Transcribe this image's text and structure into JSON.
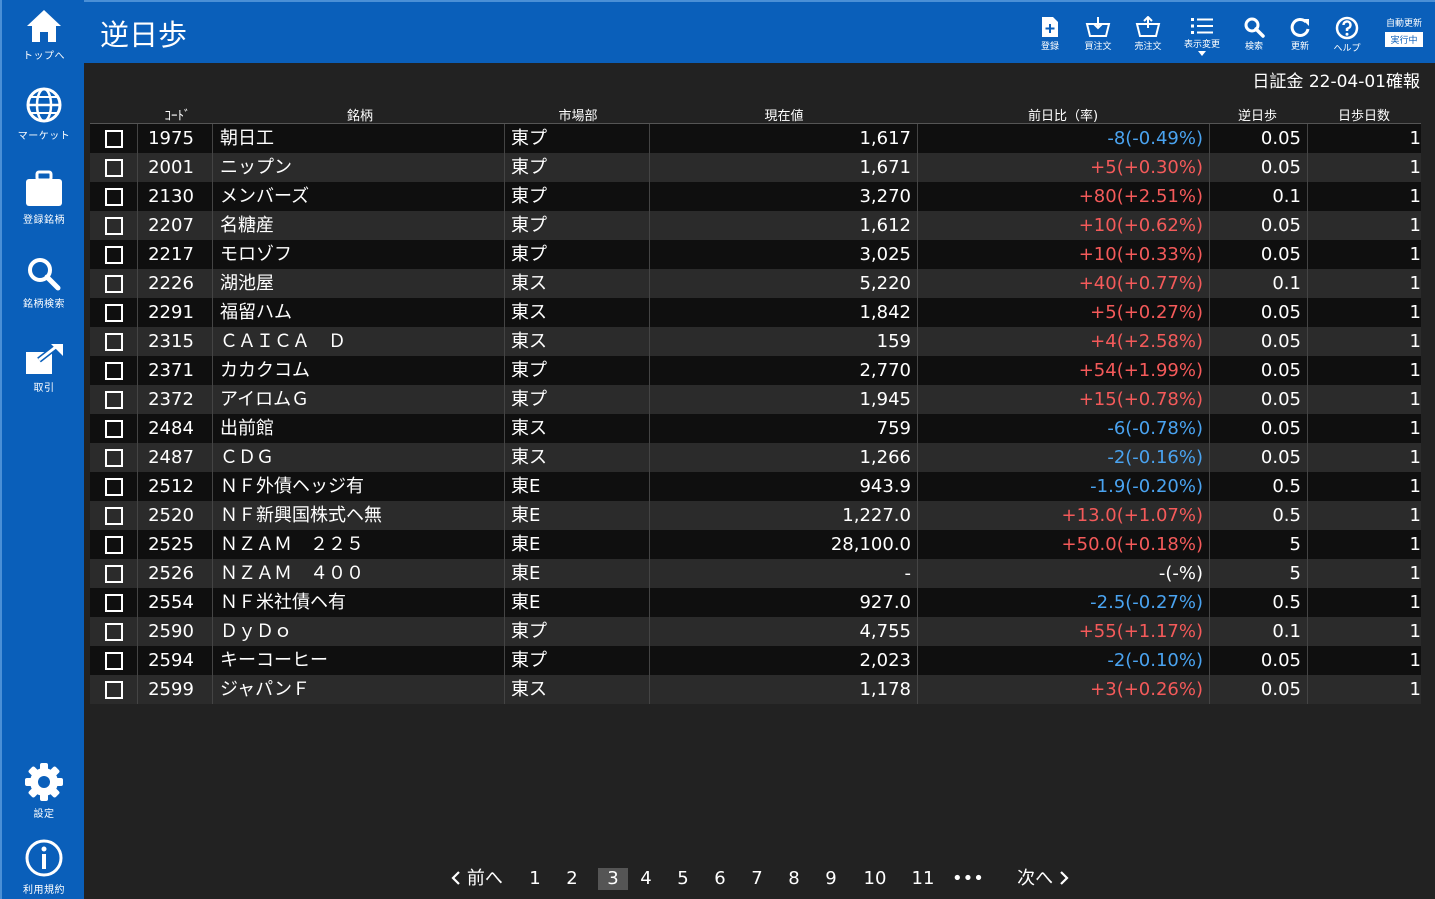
{
  "sidebar": {
    "items": [
      {
        "icon": "home-icon",
        "label": "トップへ"
      },
      {
        "icon": "globe-icon",
        "label": "マーケット"
      },
      {
        "icon": "briefcase-icon",
        "label": "登録銘柄"
      },
      {
        "icon": "search-icon",
        "label": "銘柄検索"
      },
      {
        "icon": "trade-icon",
        "label": "取引"
      },
      {
        "icon": "gear-icon",
        "label": "設定"
      },
      {
        "icon": "info-icon",
        "label": "利用規約"
      }
    ]
  },
  "header": {
    "title": "逆日歩",
    "toolbar": {
      "register": "登録",
      "buy_order": "買注文",
      "sell_order": "売注文",
      "display_change": "表示変更",
      "search": "検索",
      "refresh": "更新",
      "help": "ヘルプ",
      "auto_update_title": "自動更新",
      "auto_update_status": "実行中"
    }
  },
  "market_date": "日証金 22-04-01確報",
  "table": {
    "columns": [
      "ｺｰﾄﾞ",
      "銘柄",
      "市場部",
      "現在値",
      "前日比（率)",
      "逆日歩",
      "日歩日数"
    ],
    "rows": [
      {
        "code": "1975",
        "name": "朝日工",
        "market": "東プ",
        "price": "1,617",
        "change": "-8(-0.49%)",
        "dir": "neg",
        "gyaku": "0.05",
        "days": "1"
      },
      {
        "code": "2001",
        "name": "ニップン",
        "market": "東プ",
        "price": "1,671",
        "change": "+5(+0.30%)",
        "dir": "pos",
        "gyaku": "0.05",
        "days": "1"
      },
      {
        "code": "2130",
        "name": "メンバーズ",
        "market": "東プ",
        "price": "3,270",
        "change": "+80(+2.51%)",
        "dir": "pos",
        "gyaku": "0.1",
        "days": "1"
      },
      {
        "code": "2207",
        "name": "名糖産",
        "market": "東プ",
        "price": "1,612",
        "change": "+10(+0.62%)",
        "dir": "pos",
        "gyaku": "0.05",
        "days": "1"
      },
      {
        "code": "2217",
        "name": "モロゾフ",
        "market": "東プ",
        "price": "3,025",
        "change": "+10(+0.33%)",
        "dir": "pos",
        "gyaku": "0.05",
        "days": "1"
      },
      {
        "code": "2226",
        "name": "湖池屋",
        "market": "東ス",
        "price": "5,220",
        "change": "+40(+0.77%)",
        "dir": "pos",
        "gyaku": "0.1",
        "days": "1"
      },
      {
        "code": "2291",
        "name": "福留ハム",
        "market": "東ス",
        "price": "1,842",
        "change": "+5(+0.27%)",
        "dir": "pos",
        "gyaku": "0.05",
        "days": "1"
      },
      {
        "code": "2315",
        "name": "ＣＡＩＣＡ　Ｄ",
        "market": "東ス",
        "price": "159",
        "change": "+4(+2.58%)",
        "dir": "pos",
        "gyaku": "0.05",
        "days": "1"
      },
      {
        "code": "2371",
        "name": "カカクコム",
        "market": "東プ",
        "price": "2,770",
        "change": "+54(+1.99%)",
        "dir": "pos",
        "gyaku": "0.05",
        "days": "1"
      },
      {
        "code": "2372",
        "name": "アイロムＧ",
        "market": "東プ",
        "price": "1,945",
        "change": "+15(+0.78%)",
        "dir": "pos",
        "gyaku": "0.05",
        "days": "1"
      },
      {
        "code": "2484",
        "name": "出前館",
        "market": "東ス",
        "price": "759",
        "change": "-6(-0.78%)",
        "dir": "neg",
        "gyaku": "0.05",
        "days": "1"
      },
      {
        "code": "2487",
        "name": "ＣＤＧ",
        "market": "東ス",
        "price": "1,266",
        "change": "-2(-0.16%)",
        "dir": "neg",
        "gyaku": "0.05",
        "days": "1"
      },
      {
        "code": "2512",
        "name": "ＮＦ外債ヘッジ有",
        "market": "東E",
        "price": "943.9",
        "change": "-1.9(-0.20%)",
        "dir": "neg",
        "gyaku": "0.5",
        "days": "1"
      },
      {
        "code": "2520",
        "name": "ＮＦ新興国株式ヘ無",
        "market": "東E",
        "price": "1,227.0",
        "change": "+13.0(+1.07%)",
        "dir": "pos",
        "gyaku": "0.5",
        "days": "1"
      },
      {
        "code": "2525",
        "name": "ＮＺＡＭ　２２５",
        "market": "東E",
        "price": "28,100.0",
        "change": "+50.0(+0.18%)",
        "dir": "pos",
        "gyaku": "5",
        "days": "1"
      },
      {
        "code": "2526",
        "name": "ＮＺＡＭ　４００",
        "market": "東E",
        "price": "-",
        "change": "-(-%)",
        "dir": "flat",
        "gyaku": "5",
        "days": "1"
      },
      {
        "code": "2554",
        "name": "ＮＦ米社債ヘ有",
        "market": "東E",
        "price": "927.0",
        "change": "-2.5(-0.27%)",
        "dir": "neg",
        "gyaku": "0.5",
        "days": "1"
      },
      {
        "code": "2590",
        "name": "ＤｙＤｏ",
        "market": "東プ",
        "price": "4,755",
        "change": "+55(+1.17%)",
        "dir": "pos",
        "gyaku": "0.1",
        "days": "1"
      },
      {
        "code": "2594",
        "name": "キーコーヒー",
        "market": "東プ",
        "price": "2,023",
        "change": "-2(-0.10%)",
        "dir": "neg",
        "gyaku": "0.05",
        "days": "1"
      },
      {
        "code": "2599",
        "name": "ジャパンＦ",
        "market": "東ス",
        "price": "1,178",
        "change": "+3(+0.26%)",
        "dir": "pos",
        "gyaku": "0.05",
        "days": "1"
      }
    ]
  },
  "pagination": {
    "prev": "前へ",
    "next": "次へ",
    "pages": [
      "1",
      "2",
      "3",
      "4",
      "5",
      "6",
      "7",
      "8",
      "9",
      "10",
      "11"
    ],
    "current": "3",
    "ellipsis": "•••"
  },
  "colors": {
    "brand_blue": "#0a5fba",
    "positive": "#f45a5a",
    "negative": "#4aa3f0",
    "background": "#222222"
  }
}
